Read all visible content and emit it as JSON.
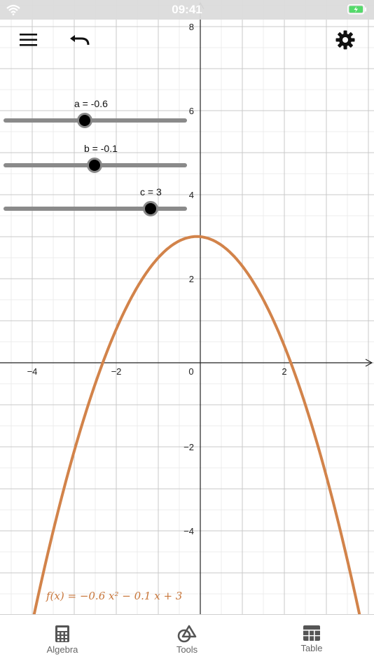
{
  "status": {
    "time": "09:41"
  },
  "sliders": [
    {
      "name": "a",
      "label": "a = -0.6",
      "min": -5,
      "max": 5,
      "value": -0.6
    },
    {
      "name": "b",
      "label": "b = -0.1",
      "min": -5,
      "max": 5,
      "value": -0.1
    },
    {
      "name": "c",
      "label": "c = 3",
      "min": -5,
      "max": 5,
      "value": 3
    }
  ],
  "graph": {
    "x_ticks": [
      "-4",
      "-2",
      "0",
      "2"
    ],
    "y_ticks": [
      "8",
      "6",
      "4",
      "2",
      "-2",
      "-4"
    ],
    "curve_color": "#d2834a",
    "formula": "f(x) = −0.6 x² − 0.1 x + 3"
  },
  "chart_data": {
    "type": "line",
    "function": {
      "a": -0.6,
      "b": -0.1,
      "c": 3
    },
    "xlim": [
      -4.8,
      4.1
    ],
    "ylim": [
      -6,
      8.3
    ],
    "grid": true
  },
  "tabs": [
    {
      "label": "Algebra",
      "icon": "calculator-icon"
    },
    {
      "label": "Tools",
      "icon": "tools-icon"
    },
    {
      "label": "Table",
      "icon": "table-icon"
    }
  ]
}
